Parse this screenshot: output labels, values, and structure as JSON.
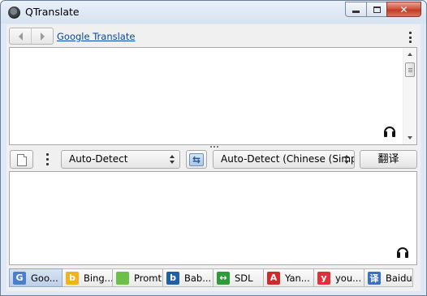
{
  "window": {
    "title": "QTranslate"
  },
  "navbar": {
    "service_link": "Google Translate"
  },
  "source": {
    "text": ""
  },
  "toolbar": {
    "source_language": "Auto-Detect",
    "target_language": "Auto-Detect (Chinese (Simp...",
    "translate_label": "翻译"
  },
  "target": {
    "text": ""
  },
  "engines": [
    {
      "label": "Goo...",
      "icon": "google-icon",
      "color": "#4a7fd0",
      "glyph": "G",
      "active": true
    },
    {
      "label": "Bing...",
      "icon": "bing-icon",
      "color": "#f2b21c",
      "glyph": "b",
      "active": false
    },
    {
      "label": "Promt",
      "icon": "promt-icon",
      "color": "#6cc04a",
      "glyph": "",
      "active": false
    },
    {
      "label": "Bab...",
      "icon": "babylon-icon",
      "color": "#1f5fa8",
      "glyph": "b",
      "active": false
    },
    {
      "label": "SDL",
      "icon": "sdl-icon",
      "color": "#2f9a3a",
      "glyph": "↔",
      "active": false
    },
    {
      "label": "Yan...",
      "icon": "yandex-icon",
      "color": "#d22a2a",
      "glyph": "A",
      "active": false
    },
    {
      "label": "you...",
      "icon": "youdao-icon",
      "color": "#e0303a",
      "glyph": "y",
      "active": false
    },
    {
      "label": "Baidu",
      "icon": "baidu-icon",
      "color": "#3a6fc6",
      "glyph": "译",
      "active": false
    }
  ]
}
